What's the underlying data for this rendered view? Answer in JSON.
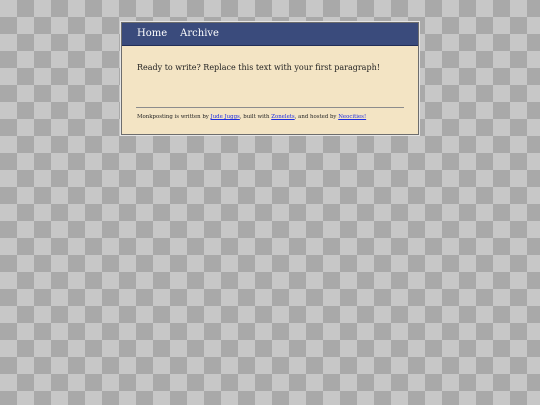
{
  "nav": {
    "home_label": "Home",
    "archive_label": "Archive"
  },
  "main": {
    "paragraph": "Ready to write? Replace this text with your first paragraph!"
  },
  "footer": {
    "prefix": "Monkposting is written by ",
    "author_link": "Jude Juggs",
    "middle_1": ", built with ",
    "builder_link": "Zonelets",
    "middle_2": ", and hosted by ",
    "host_link": "Neocities!"
  },
  "colors": {
    "nav_background": "#3a4b7c",
    "page_background": "#f3e4c4",
    "link": "#1e2ee0"
  }
}
